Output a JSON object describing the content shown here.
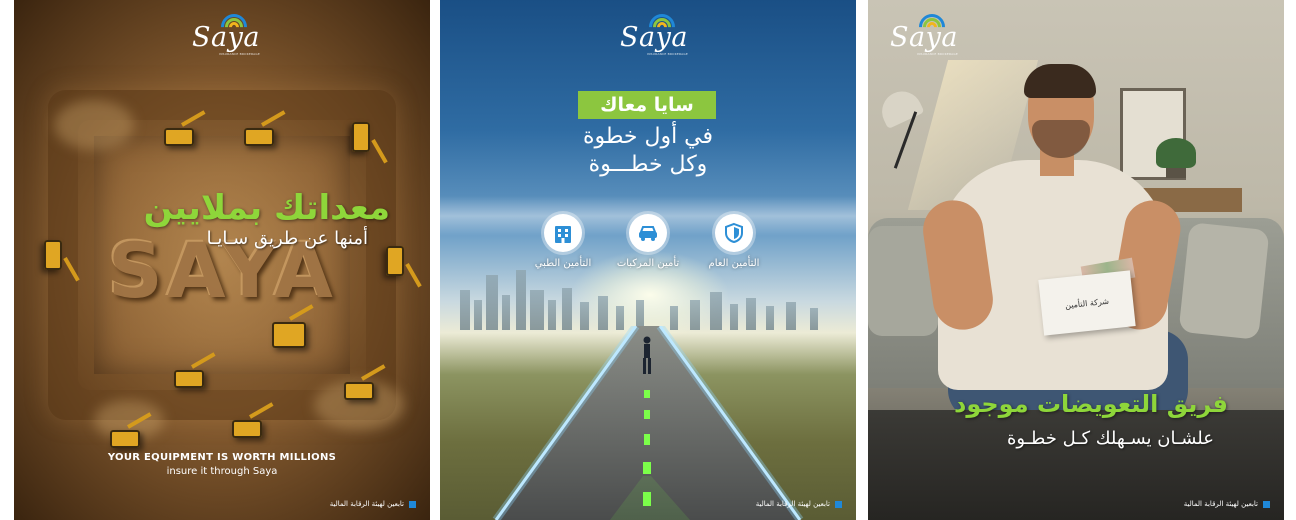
{
  "brand": {
    "logo_text": "Saya",
    "logo_sub": "INSURANCE BROKERAGE",
    "arc_colors": [
      "#1f88d8",
      "#8cc63f",
      "#f2b51d"
    ]
  },
  "footer_text": "تابعين لهيئة الرقابة المالية",
  "posters": [
    {
      "headline": "معداتك بملايين",
      "subline": "أمنها عن طريق سـايـا",
      "big_word": "SAYA",
      "english_line1": "YOUR EQUIPMENT IS WORTH MILLIONS",
      "english_line2": "insure it through Saya"
    },
    {
      "banner": "سايا معاك",
      "line1": "في أول خطوة",
      "line2": "وكل خطـــوة",
      "services": [
        {
          "label": "التأمين الطبي",
          "icon": "hospital-icon"
        },
        {
          "label": "تأمين المركبات",
          "icon": "car-icon"
        },
        {
          "label": "التأمين العام",
          "icon": "shield-icon"
        }
      ]
    },
    {
      "envelope_label": "شركة التأمين",
      "headline": "فريق التعويضات موجود",
      "subline": "علشـان يسـهلك كـل خطـوة"
    }
  ],
  "colors": {
    "accent_green": "#8cc63f",
    "headline_green": "#8ed63a",
    "accent_blue": "#1f88d8"
  }
}
